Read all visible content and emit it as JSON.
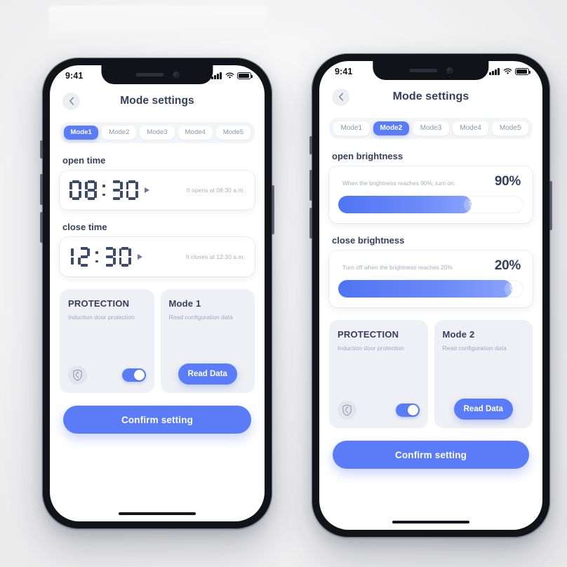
{
  "theme": {
    "accent": "#5b7cf7",
    "accent_dark": "#4f73f3",
    "text_dark": "#343f5c",
    "text_muted": "#a8aebe",
    "panel_bg": "#eef0f5",
    "screen_bg": "#ffffff"
  },
  "phone1": {
    "status_bar": {
      "time": "9:41",
      "signal_icon": "signal-bars-icon",
      "wifi_icon": "wifi-icon",
      "battery_icon": "battery-icon"
    },
    "header": {
      "back_icon": "chevron-left-icon",
      "title": "Mode settings"
    },
    "tabs": [
      {
        "label": "Mode1",
        "active": true
      },
      {
        "label": "Mode2",
        "active": false
      },
      {
        "label": "Mode3",
        "active": false
      },
      {
        "label": "Mode4",
        "active": false
      },
      {
        "label": "Mode5",
        "active": false
      }
    ],
    "open_time": {
      "label": "open time",
      "value": "08:30",
      "digits": [
        "0",
        "8",
        "3",
        "0"
      ],
      "caret_icon": "play-caret-icon",
      "hint": "It opens at 08:30 a.m."
    },
    "close_time": {
      "label": "close time",
      "value": "12:30",
      "digits": [
        "1",
        "2",
        "3",
        "0"
      ],
      "caret_icon": "play-caret-icon",
      "hint": "It closes at 12:30 a.m."
    },
    "protection": {
      "title": "PROTECTION",
      "description": "Induction door protection",
      "icon": "shield-chicken-icon",
      "toggle_on": true
    },
    "mode_card": {
      "title": "Mode 1",
      "description": "Read configuration data",
      "button_label": "Read Data"
    },
    "confirm_label": "Confirm setting"
  },
  "phone2": {
    "status_bar": {
      "time": "9:41",
      "signal_icon": "signal-bars-icon",
      "wifi_icon": "wifi-icon",
      "battery_icon": "battery-icon"
    },
    "header": {
      "back_icon": "chevron-left-icon",
      "title": "Mode settings"
    },
    "tabs": [
      {
        "label": "Mode1",
        "active": false
      },
      {
        "label": "Mode2",
        "active": true
      },
      {
        "label": "Mode3",
        "active": false
      },
      {
        "label": "Mode4",
        "active": false
      },
      {
        "label": "Mode5",
        "active": false
      }
    ],
    "open_brightness": {
      "label": "open brightness",
      "description": "When the brightness reaches 90%, turn on.",
      "value_label": "90%",
      "fill_percent": 72,
      "thumb_icon": "bulb-icon"
    },
    "close_brightness": {
      "label": "close brightness",
      "description": "Turn off when the brightness reaches 20%",
      "value_label": "20%",
      "fill_percent": 94,
      "thumb_icon": "bulb-icon"
    },
    "protection": {
      "title": "PROTECTION",
      "description": "Induction door protection",
      "icon": "shield-chicken-icon",
      "toggle_on": true
    },
    "mode_card": {
      "title": "Mode 2",
      "description": "Read configuration data",
      "button_label": "Read Data"
    },
    "confirm_label": "Confirm setting"
  }
}
